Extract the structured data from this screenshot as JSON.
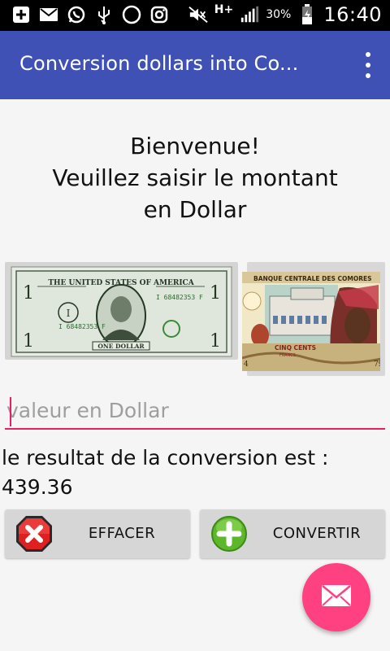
{
  "status_bar": {
    "battery_percent": "30%",
    "time": "16:40",
    "network_label": "H+",
    "icons": [
      "plus-box-icon",
      "mail-icon",
      "whatsapp-icon",
      "usb-icon",
      "moon-icon",
      "instagram-icon",
      "mute-icon",
      "signal-icon",
      "battery-icon"
    ]
  },
  "app_bar": {
    "title": "Conversion dollars into Co...",
    "color": "#3F51B5"
  },
  "welcome": {
    "line1": "Bienvenue!",
    "line2": "Veuillez saisir le montant",
    "line3": "en Dollar"
  },
  "images": {
    "usd_bill": {
      "header": "THE UNITED STATES OF AMERICA",
      "serial": "I 68482353 F",
      "denomination": "ONE DOLLAR",
      "corner_numeral": "1"
    },
    "kmf_bill": {
      "header": "BANQUE CENTRALE DES COMORES",
      "denomination": "CINQ CENTS",
      "sub": "FRANCS"
    }
  },
  "input": {
    "placeholder": "valeur en Dollar",
    "value": ""
  },
  "result": {
    "label": "le resultat de la conversion est :",
    "value": "439.36"
  },
  "buttons": {
    "clear_label": "EFFACER",
    "convert_label": "CONVERTIR"
  },
  "accent_color": "#FF4081",
  "fab_icon": "mail-icon"
}
